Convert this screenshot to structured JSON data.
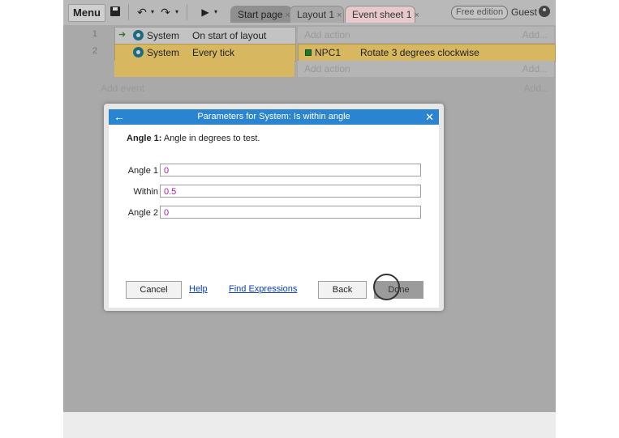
{
  "toolbar": {
    "menu_label": "Menu",
    "tabs": [
      {
        "label": "Start page"
      },
      {
        "label": "Layout 1"
      },
      {
        "label": "Event sheet 1"
      }
    ],
    "tab_close_glyph": "×",
    "free_edition_label": "Free edition",
    "guest_label": "Guest",
    "icons": [
      "save-icon",
      "undo-icon",
      "redo-icon",
      "play-icon"
    ]
  },
  "events": [
    {
      "line": "1",
      "object": "System",
      "condition": "On start of layout",
      "action_placeholder": "Add action",
      "add_label": "Add..."
    },
    {
      "line": "2",
      "object": "System",
      "condition": "Every tick",
      "action_object": "NPC1",
      "action_text": "Rotate 3 degrees clockwise",
      "action_placeholder": "Add action",
      "add_label": "Add..."
    }
  ],
  "add_event_label": "Add event",
  "add_event_right": "Add...",
  "dialog": {
    "title": "Parameters for System: Is within angle",
    "description_bold": "Angle 1:",
    "description_text": " Angle in degrees to test.",
    "params": [
      {
        "label": "Angle 1",
        "value": "0"
      },
      {
        "label": "Within",
        "value": "0.5"
      },
      {
        "label": "Angle 2",
        "value": "0"
      }
    ],
    "cancel_label": "Cancel",
    "help_label": "Help",
    "find_expressions_label": "Find Expressions",
    "back_label": "Back",
    "done_label": "Done"
  },
  "colors": {
    "dialog_title_bar": "#2b84d0",
    "selected_event": "#d7b760",
    "param_value_text": "#a020a0",
    "link": "#0a3ccc"
  }
}
